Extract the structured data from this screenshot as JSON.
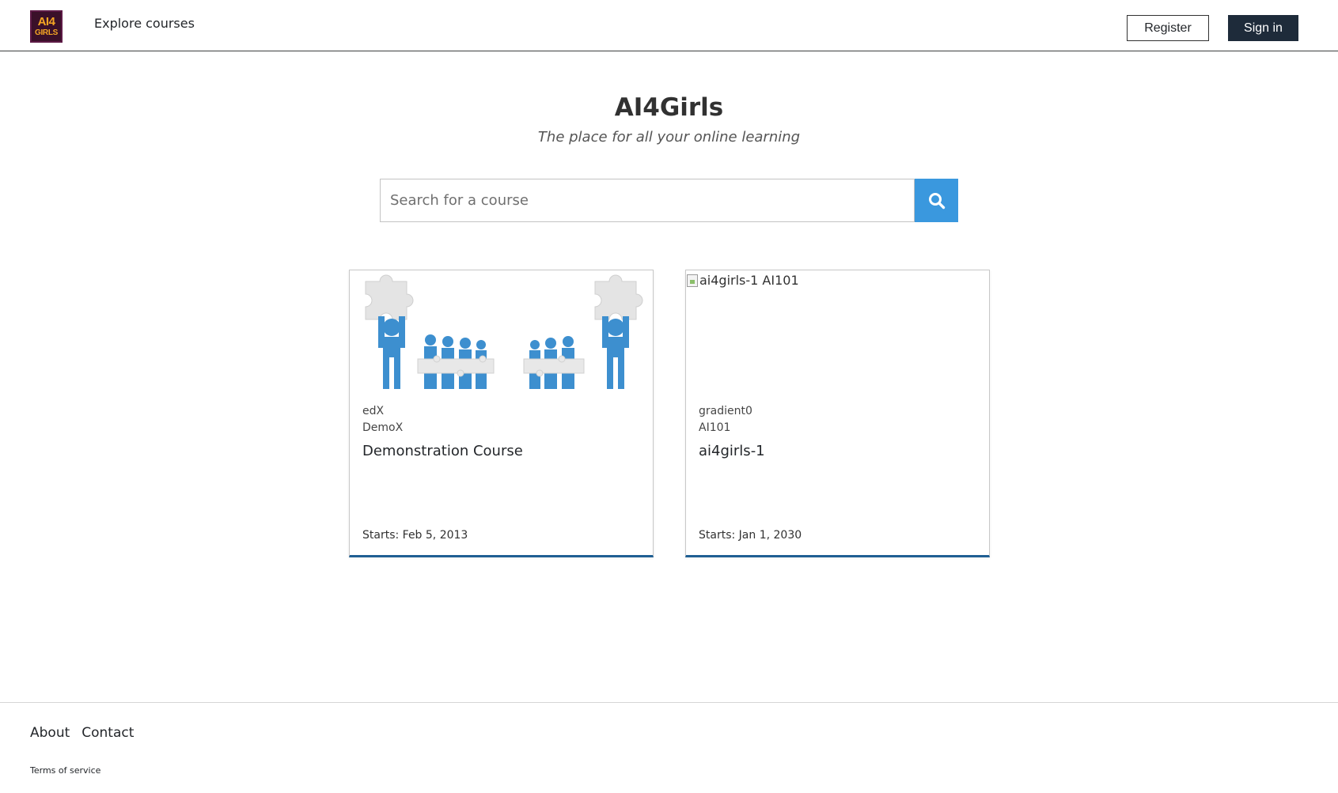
{
  "header": {
    "logo_lines": [
      "AI4",
      "GIRLS"
    ],
    "explore_label": "Explore courses",
    "register_label": "Register",
    "signin_label": "Sign in"
  },
  "hero": {
    "title": "AI4Girls",
    "subtitle": "The place for all your online learning"
  },
  "search": {
    "placeholder": "Search for a course",
    "value": ""
  },
  "courses": [
    {
      "org": "edX",
      "code": "DemoX",
      "name": "Demonstration Course",
      "start": "Starts: Feb 5, 2013",
      "image_alt": "",
      "image_icon": "puzzle-people-image"
    },
    {
      "org": "gradient0",
      "code": "AI101",
      "name": "ai4girls-1",
      "start": "Starts: Jan 1, 2030",
      "image_alt": "ai4girls-1 AI101"
    }
  ],
  "footer": {
    "about_label": "About",
    "contact_label": "Contact",
    "tos_label": "Terms of service"
  },
  "colors": {
    "search_button": "#3a98de",
    "signin_button": "#1e2b3a",
    "card_accent": "#1f5f93",
    "logo_bg": "#3a1029",
    "logo_text": "#f5a623"
  }
}
